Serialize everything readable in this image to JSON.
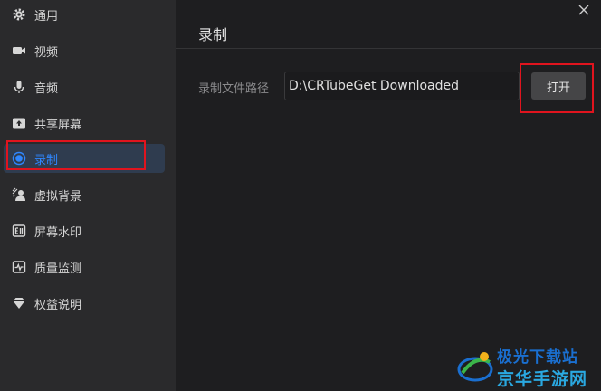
{
  "sidebar": {
    "items": [
      {
        "label": "通用",
        "icon": "gear-icon"
      },
      {
        "label": "视频",
        "icon": "camera-icon"
      },
      {
        "label": "音频",
        "icon": "microphone-icon"
      },
      {
        "label": "共享屏幕",
        "icon": "share-screen-icon"
      },
      {
        "label": "录制",
        "icon": "record-icon",
        "active": true
      },
      {
        "label": "虚拟背景",
        "icon": "virtual-background-icon"
      },
      {
        "label": "屏幕水印",
        "icon": "watermark-icon"
      },
      {
        "label": "质量监测",
        "icon": "pulse-icon"
      },
      {
        "label": "权益说明",
        "icon": "diamond-icon"
      }
    ]
  },
  "main": {
    "title": "录制",
    "path_label": "录制文件路径",
    "path_value": "D:\\CRTubeGet Downloaded",
    "open_button": "打开"
  },
  "watermark": {
    "top": "极光下载站",
    "bottom": "京华手游网"
  },
  "colors": {
    "accent": "#2f87ff",
    "highlight": "#e0141e",
    "sidebar_bg": "#2a2a2c",
    "main_bg": "#1e1e20"
  }
}
